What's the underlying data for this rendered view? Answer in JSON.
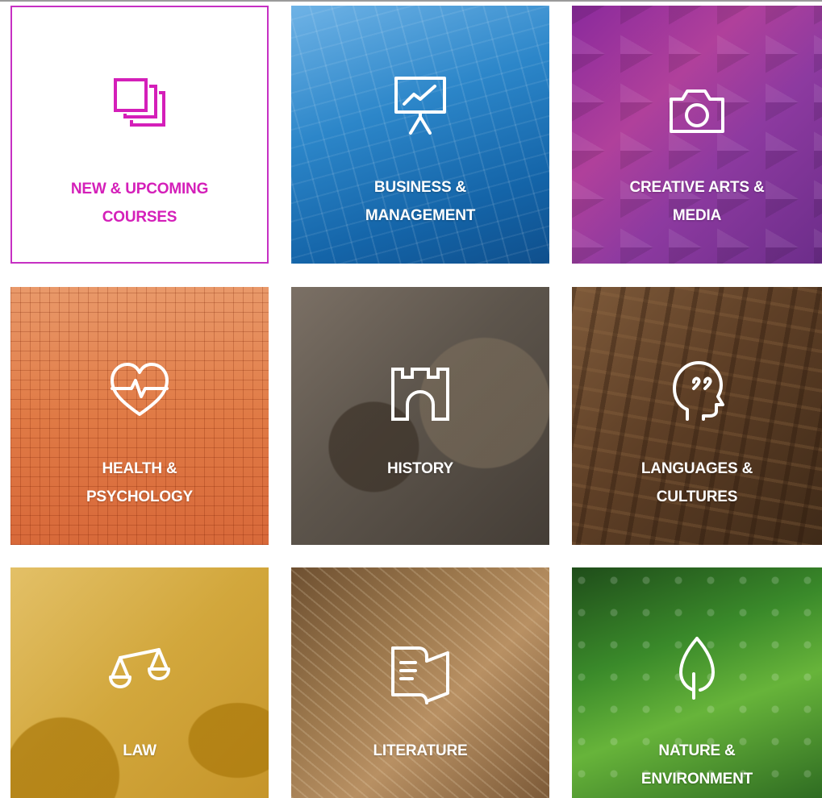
{
  "colors": {
    "featured_accent": "#c630c3",
    "featured_text": "#d41fb9",
    "tile_text": "#ffffff"
  },
  "tiles": [
    {
      "label_line1": "NEW & UPCOMING",
      "label_line2": "COURSES",
      "icon": "stacked-pages-icon"
    },
    {
      "label_line1": "BUSINESS &",
      "label_line2": "MANAGEMENT",
      "icon": "presentation-chart-icon"
    },
    {
      "label_line1": "CREATIVE ARTS &",
      "label_line2": "MEDIA",
      "icon": "camera-icon"
    },
    {
      "label_line1": "HEALTH &",
      "label_line2": "PSYCHOLOGY",
      "icon": "heartbeat-icon"
    },
    {
      "label_line1": "HISTORY",
      "label_line2": "",
      "icon": "castle-icon"
    },
    {
      "label_line1": "LANGUAGES &",
      "label_line2": "CULTURES",
      "icon": "speaking-head-icon"
    },
    {
      "label_line1": "LAW",
      "label_line2": "",
      "icon": "scales-icon"
    },
    {
      "label_line1": "LITERATURE",
      "label_line2": "",
      "icon": "open-book-icon"
    },
    {
      "label_line1": "NATURE &",
      "label_line2": "ENVIRONMENT",
      "icon": "leaf-icon"
    }
  ]
}
